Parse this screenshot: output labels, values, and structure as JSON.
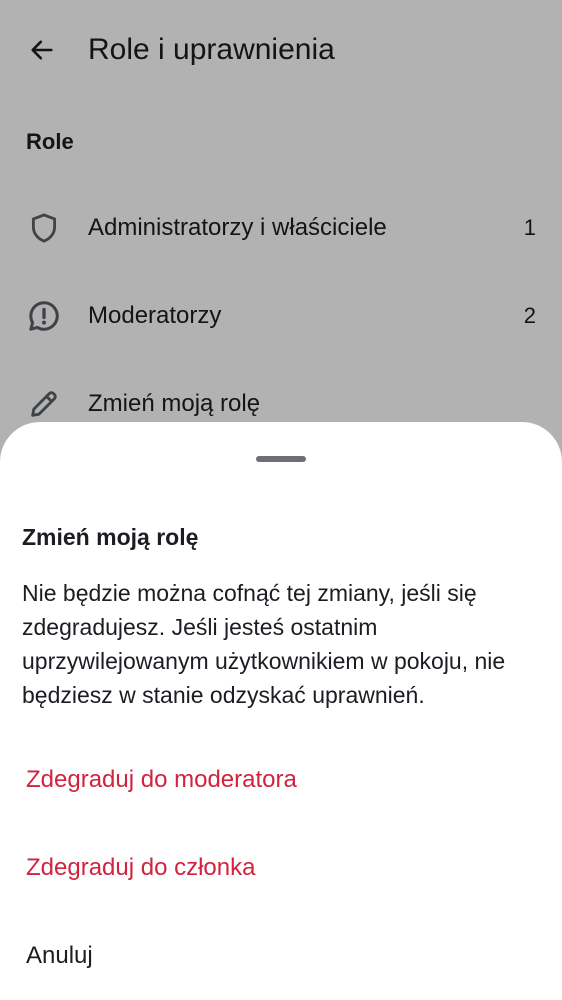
{
  "app_bar": {
    "title": "Role i uprawnienia",
    "back_icon": "arrow-left-icon"
  },
  "roles_section": {
    "title": "Role",
    "items": [
      {
        "label": "Administratorzy i właściciele",
        "count": "1",
        "icon": "shield-icon"
      },
      {
        "label": "Moderatorzy",
        "count": "2",
        "icon": "chat-alert-icon"
      },
      {
        "label": "Zmień moją rolę",
        "icon": "pencil-icon"
      }
    ]
  },
  "sheet": {
    "title": "Zmień moją rolę",
    "body": "Nie będzie można cofnąć tej zmiany, jeśli się zdegradujesz. Jeśli jesteś ostatnim uprzywilejowanym użytkownikiem w pokoju, nie będziesz w stanie odzyskać uprawnień.",
    "actions": [
      {
        "label": "Zdegraduj do moderatora",
        "color": "#d1233f"
      },
      {
        "label": "Zdegraduj do członka",
        "color": "#d1233f"
      },
      {
        "label": "Anuluj",
        "color": "#1b1d22"
      }
    ]
  },
  "colors": {
    "critical": "#d1233f",
    "text": "#1b1d22",
    "scrim": "rgba(0,0,0,0.30)"
  }
}
